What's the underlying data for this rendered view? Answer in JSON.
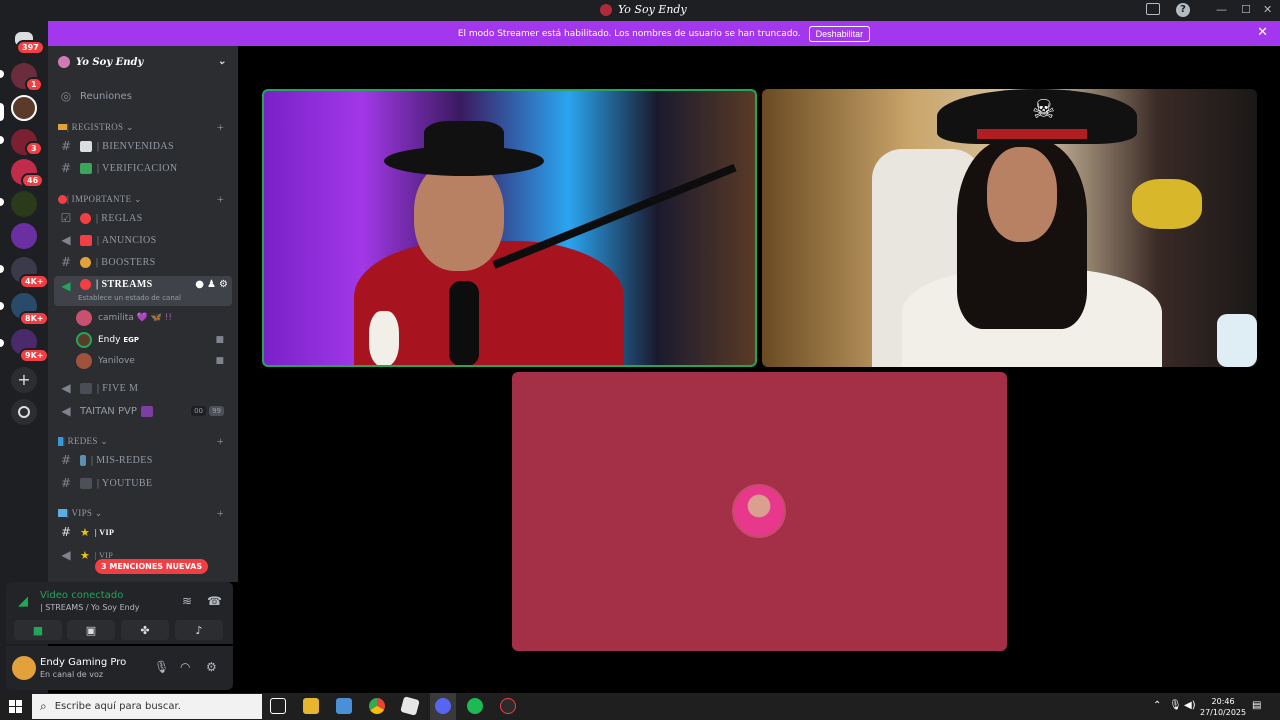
{
  "titlebar": {
    "title": "Yo Soy Endy"
  },
  "banner": {
    "message": "El modo Streamer está habilitado. Los nombres de usuario se han truncado.",
    "button": "Deshabilitar",
    "close": "✕"
  },
  "rail": {
    "badges": [
      "397",
      "1",
      "3",
      "46",
      "4K+",
      "8K+",
      "9K+"
    ]
  },
  "sidebar": {
    "server_name": "Yo Soy Endy",
    "meetings_label": "Reuniones",
    "categories": {
      "registros": "| REGISTROS",
      "importante": "| IMPORTANTE",
      "redes": "| REDES",
      "vips": "| VIPS"
    },
    "channels": {
      "bienvenidas": "| BIENVENIDAS",
      "verificacion": "| VERIFICACION",
      "reglas": "| REGLAS",
      "anuncios": "| ANUNCIOS",
      "boosters": "| BOOSTERS",
      "streams": "| STREAMS",
      "streams_sub": "Establece un estado de canal",
      "five_m": "| FIVE M",
      "taitan": "TAITAN PVP",
      "taitan_count1": "00",
      "taitan_count2": "99",
      "mis_redes": "| MIS-REDES",
      "youtube": "| YOUTUBE",
      "vip1": "| VIP",
      "vip2": "| VIP"
    },
    "voice_users": [
      {
        "name": "camilita",
        "tag": "💜 🦋 !!"
      },
      {
        "name": "Endy",
        "tag": "EGP"
      },
      {
        "name": "Yanilove",
        "tag": ""
      }
    ],
    "mentions": "3 MENCIONES NUEVAS"
  },
  "voice_panel": {
    "status": "Video conectado",
    "channel": "| STREAMS / Yo Soy Endy"
  },
  "user_panel": {
    "name": "Endy Gaming Pro",
    "status": "En canal de voz"
  },
  "taskbar": {
    "search_placeholder": "Escribe aquí para buscar.",
    "time": "20:46",
    "date": "27/10/2025"
  },
  "colors": {
    "banner": "#a337ee",
    "speaking_border": "#23a55a",
    "tile3_bg": "#a33047",
    "mention_red": "#f23f43"
  }
}
